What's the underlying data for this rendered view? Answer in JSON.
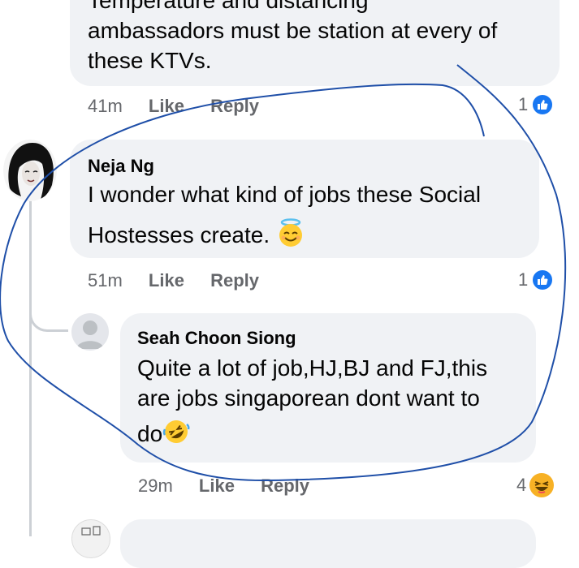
{
  "comments": [
    {
      "id": "c0",
      "text_line_1": "Temperature and distancing",
      "text_line_2": "ambassadors must be station at every of",
      "text_line_3": "these KTVs.",
      "time": "41m",
      "like_label": "Like",
      "reply_label": "Reply",
      "reaction_count": "1",
      "reaction_icon": "like-icon"
    },
    {
      "id": "c1",
      "author": "Neja Ng",
      "text_line_1": "I wonder what kind of jobs these Social",
      "text_line_2": "Hostesses create.",
      "emoji": "smiling-face-with-halo",
      "time": "51m",
      "like_label": "Like",
      "reply_label": "Reply",
      "reaction_count": "1",
      "reaction_icon": "like-icon"
    },
    {
      "id": "c2",
      "author": "Seah Choon Siong",
      "text_line_1": "Quite a lot of job,HJ,BJ and FJ,this",
      "text_line_2": "are jobs singaporean dont want to",
      "text_line_3": "do",
      "emoji": "rolling-on-floor-laughing",
      "time": "29m",
      "like_label": "Like",
      "reply_label": "Reply",
      "reaction_count": "4",
      "reaction_icon": "haha-icon"
    }
  ],
  "colors": {
    "bubble": "#f0f2f5",
    "meta_text": "#65676b",
    "like_blue": "#1877f2",
    "annotation_ink": "#1f4fa8"
  }
}
